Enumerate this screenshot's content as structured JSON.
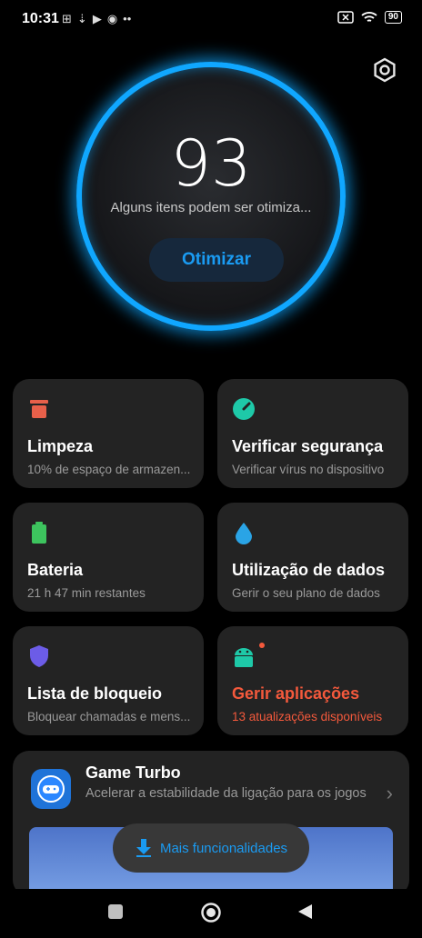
{
  "status_bar": {
    "time": "10:31",
    "battery": "90"
  },
  "score": {
    "value": "93",
    "subtitle": "Alguns itens podem ser otimiza...",
    "button_label": "Otimizar",
    "ring_color": "#10a7ff"
  },
  "cards": [
    {
      "title": "Limpeza",
      "desc": "10% de espaço de armazen...",
      "icon": "trash-icon",
      "color": "#e8604a"
    },
    {
      "title": "Verificar segurança",
      "desc": "Verificar vírus no dispositivo",
      "icon": "security-scan-icon",
      "color": "#1ec9a8"
    },
    {
      "title": "Bateria",
      "desc": "21 h 47 min  restantes",
      "icon": "battery-icon",
      "color": "#3dc45e"
    },
    {
      "title": "Utilização de dados",
      "desc": "Gerir o seu plano de dados",
      "icon": "water-drop-icon",
      "color": "#2aa4e6"
    },
    {
      "title": "Lista de bloqueio",
      "desc": "Bloquear chamadas e mens...",
      "icon": "shield-icon",
      "color": "#6c5ce7"
    },
    {
      "title": "Gerir aplicações",
      "desc": "13 atualizações disponíveis",
      "icon": "android-apps-icon",
      "color": "#1ec9a8",
      "accent": "#f4593c"
    }
  ],
  "game_turbo": {
    "title": "Game Turbo",
    "desc": "Acelerar a estabilidade da ligação para os jogos"
  },
  "toast": {
    "label": "Mais funcionalidades"
  }
}
